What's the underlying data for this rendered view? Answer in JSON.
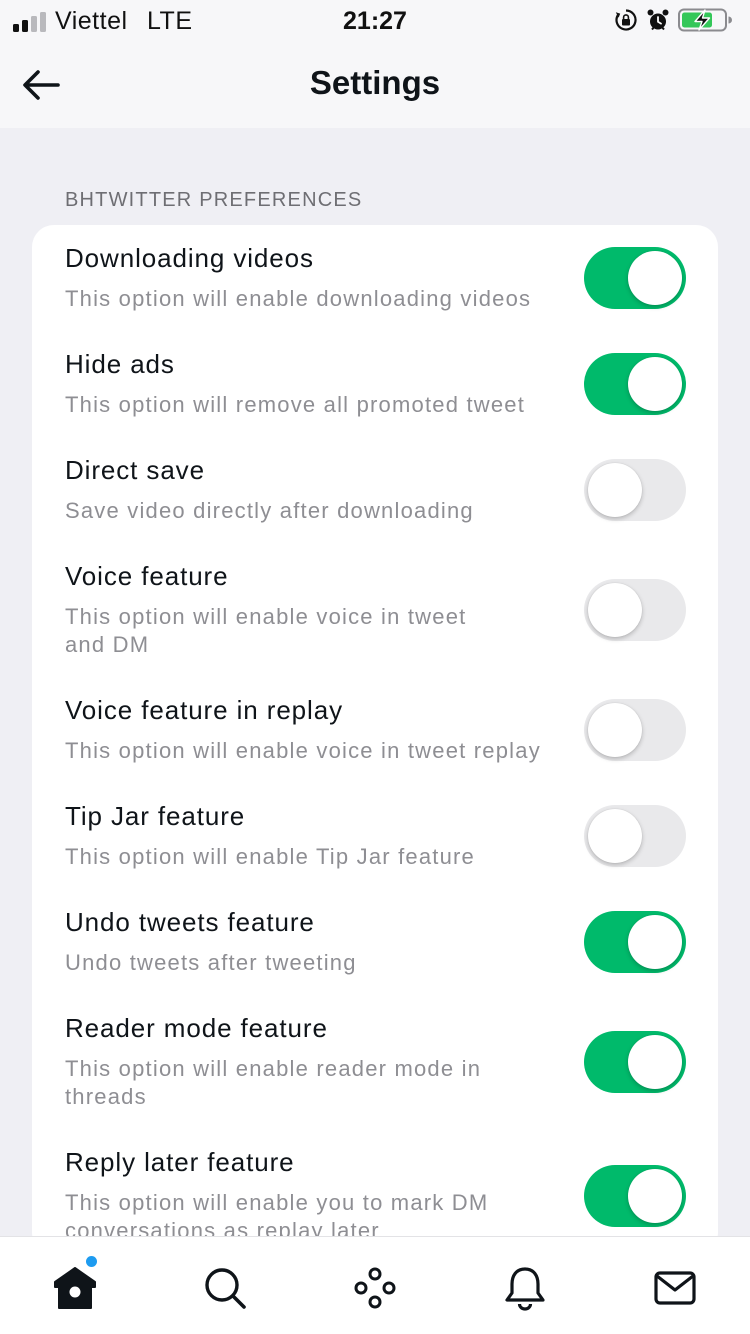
{
  "status_bar": {
    "carrier": "Viettel",
    "network": "LTE",
    "time": "21:27"
  },
  "nav": {
    "title": "Settings"
  },
  "section": {
    "header": "BHTWITTER PREFERENCES"
  },
  "settings": [
    {
      "title": "Downloading videos",
      "subtitle": "This option will enable downloading videos",
      "enabled": true
    },
    {
      "title": "Hide ads",
      "subtitle": "This option will remove all promoted tweet",
      "enabled": true
    },
    {
      "title": "Direct save",
      "subtitle": "Save video directly after downloading",
      "enabled": false
    },
    {
      "title": "Voice feature",
      "subtitle": "This option will enable voice in tweet and DM",
      "enabled": false
    },
    {
      "title": "Voice feature in replay",
      "subtitle": "This option will enable voice in tweet replay",
      "enabled": false
    },
    {
      "title": "Tip Jar feature",
      "subtitle": "This option will enable Tip Jar feature",
      "enabled": false
    },
    {
      "title": "Undo tweets feature",
      "subtitle": "Undo tweets after tweeting",
      "enabled": true
    },
    {
      "title": "Reader mode feature",
      "subtitle": "This option will enable reader mode in threads",
      "enabled": true
    },
    {
      "title": "Reply later feature",
      "subtitle": "This option will enable you to mark DM conversations as replay later",
      "enabled": true
    }
  ],
  "colors": {
    "toggle_on": "#00ba6b",
    "toggle_off": "#e9e9eb",
    "notification_dot": "#1d9bf0"
  },
  "tab_bar": {
    "icons": [
      "home-icon",
      "search-icon",
      "spaces-icon",
      "notifications-icon",
      "messages-icon"
    ]
  }
}
